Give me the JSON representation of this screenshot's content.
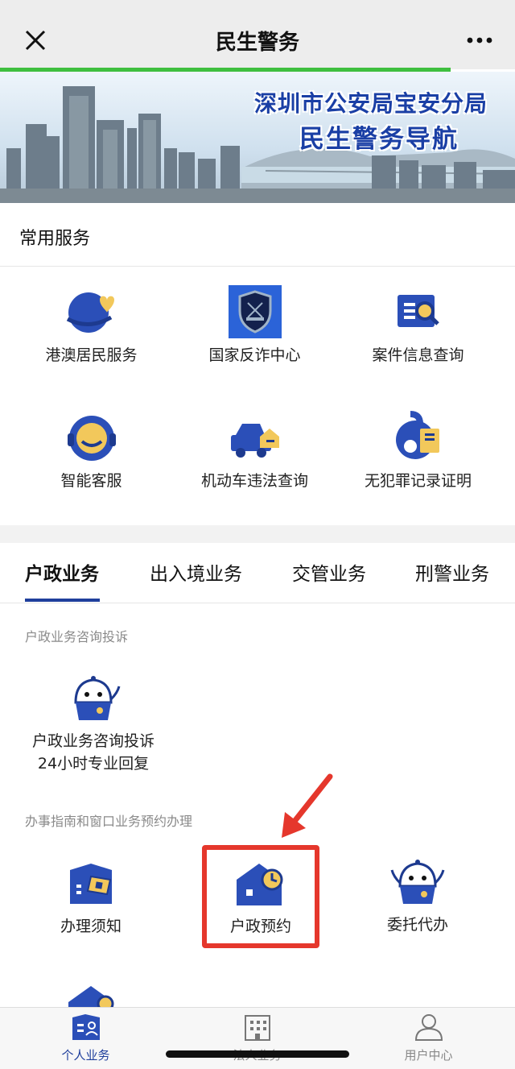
{
  "nav": {
    "title": "民生警务",
    "close_icon": "close-icon",
    "more_icon": "more-icon"
  },
  "banner": {
    "line1": "深圳市公安局宝安分局",
    "line2": "民生警务导航"
  },
  "common": {
    "title": "常用服务",
    "items": [
      {
        "label": "港澳居民服务",
        "icon": "globe-heart-icon"
      },
      {
        "label": "国家反诈中心",
        "icon": "police-badge-icon"
      },
      {
        "label": "案件信息查询",
        "icon": "document-search-icon"
      },
      {
        "label": "智能客服",
        "icon": "headset-icon"
      },
      {
        "label": "机动车违法查询",
        "icon": "car-icon"
      },
      {
        "label": "无犯罪记录证明",
        "icon": "certificate-icon"
      }
    ]
  },
  "tabs": [
    {
      "label": "户政业务",
      "active": true
    },
    {
      "label": "出入境业务",
      "active": false
    },
    {
      "label": "交管业务",
      "active": false
    },
    {
      "label": "刑警业务",
      "active": false
    }
  ],
  "section1": {
    "heading": "户政业务咨询投诉",
    "item": {
      "line1": "户政业务咨询投诉",
      "line2": "24小时专业回复",
      "icon": "mascot-icon"
    }
  },
  "section2": {
    "heading": "办事指南和窗口业务预约办理",
    "items": [
      {
        "label": "办理须知",
        "icon": "notice-card-icon"
      },
      {
        "label": "户政预约",
        "icon": "house-clock-icon"
      },
      {
        "label": "委托代办",
        "icon": "mascot-icon"
      }
    ]
  },
  "tabbar": {
    "items": [
      {
        "label": "个人业务",
        "active": true,
        "icon": "person-card-icon"
      },
      {
        "label": "法人业务",
        "active": false,
        "icon": "building-icon"
      },
      {
        "label": "用户中心",
        "active": false,
        "icon": "user-icon"
      }
    ]
  },
  "colors": {
    "accent": "#1f3f9c",
    "icon_blue": "#2b4fb8",
    "icon_gold": "#f2c85b",
    "highlight": "#e5372c",
    "progress": "#3fbf3f"
  }
}
